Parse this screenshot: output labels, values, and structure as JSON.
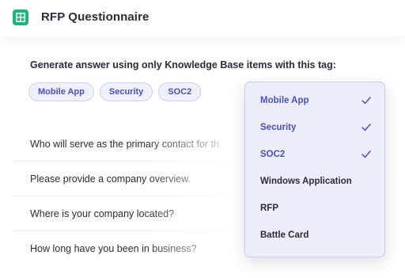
{
  "header": {
    "title": "RFP Questionnaire",
    "icon": "table-grid-icon",
    "icon_color": "#1fb57a"
  },
  "tag_prompt": "Generate answer using only Knowledge Base items with this tag:",
  "tags": [
    {
      "label": "Mobile App"
    },
    {
      "label": "Security"
    },
    {
      "label": "SOC2"
    }
  ],
  "questions": [
    {
      "text": "Who will serve as the primary contact for th"
    },
    {
      "text": "Please provide a company overview."
    },
    {
      "text": "Where is your company located?"
    },
    {
      "text": "How long have you been in business?"
    }
  ],
  "dropdown": {
    "accent_color": "#4b4fc9",
    "options": [
      {
        "label": "Mobile App",
        "selected": true
      },
      {
        "label": "Security",
        "selected": true
      },
      {
        "label": "SOC2",
        "selected": true
      },
      {
        "label": "Windows Application",
        "selected": false
      },
      {
        "label": "RFP",
        "selected": false
      },
      {
        "label": "Battle Card",
        "selected": false
      }
    ]
  }
}
